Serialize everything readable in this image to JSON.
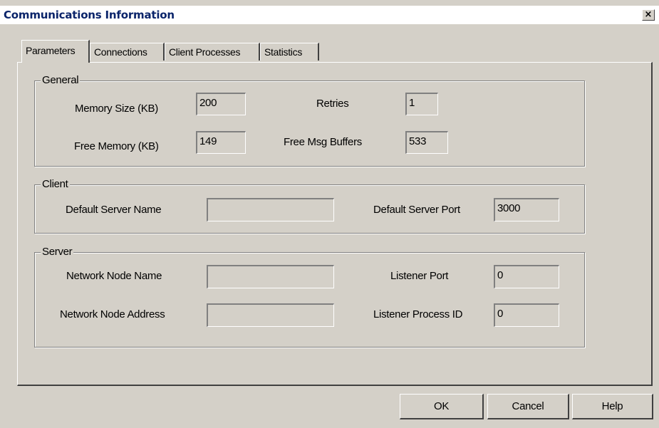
{
  "window": {
    "title": "Communications Information",
    "close_glyph": "×"
  },
  "tabs": [
    {
      "label": "Parameters",
      "active": true
    },
    {
      "label": "Connections",
      "active": false
    },
    {
      "label": "Client Processes",
      "active": false
    },
    {
      "label": "Statistics",
      "active": false
    }
  ],
  "general": {
    "legend": "General",
    "memory_size": {
      "label": "Memory Size (KB)",
      "value": "200"
    },
    "retries": {
      "label": "Retries",
      "value": "1"
    },
    "free_memory": {
      "label": "Free Memory (KB)",
      "value": "149"
    },
    "free_msg_buffers": {
      "label": "Free Msg Buffers",
      "value": "533"
    }
  },
  "client": {
    "legend": "Client",
    "default_server_name": {
      "label": "Default Server Name",
      "value": ""
    },
    "default_server_port": {
      "label": "Default Server Port",
      "value": "3000"
    }
  },
  "server": {
    "legend": "Server",
    "network_node_name": {
      "label": "Network Node Name",
      "value": ""
    },
    "listener_port": {
      "label": "Listener Port",
      "value": "0"
    },
    "network_node_address": {
      "label": "Network Node Address",
      "value": ""
    },
    "listener_process_id": {
      "label": "Listener Process ID",
      "value": "0"
    }
  },
  "buttons": {
    "ok": "OK",
    "cancel": "Cancel",
    "help": "Help"
  }
}
